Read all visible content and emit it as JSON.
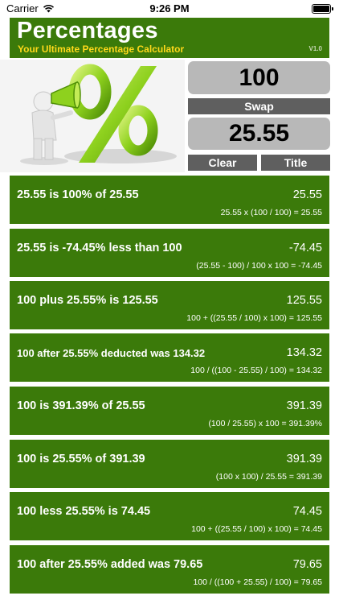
{
  "status_bar": {
    "carrier": "Carrier",
    "time": "9:26 PM"
  },
  "header": {
    "title": "Percentages",
    "subtitle": "Your Ultimate Percentage Calculator",
    "version": "V1.0"
  },
  "inputs": {
    "value_a": "100",
    "value_b": "25.55"
  },
  "buttons": {
    "swap": "Swap",
    "clear": "Clear",
    "title": "Title"
  },
  "hero": {
    "icon": "percent-megaphone-illustration"
  },
  "results": [
    {
      "statement": "25.55 is 100% of 25.55",
      "value": "25.55",
      "formula": "25.55 x (100 / 100) = 25.55"
    },
    {
      "statement": "25.55 is -74.45% less than 100",
      "value": "-74.45",
      "formula": "(25.55 - 100) / 100 x 100 = -74.45"
    },
    {
      "statement": "100 plus 25.55% is 125.55",
      "value": "125.55",
      "formula": "100 + ((25.55 / 100) x 100) = 125.55"
    },
    {
      "statement": "100 after 25.55% deducted was 134.32",
      "value": "134.32",
      "formula": "100 / ((100 - 25.55) / 100) = 134.32"
    },
    {
      "statement": "100 is 391.39% of 25.55",
      "value": "391.39",
      "formula": "(100 / 25.55) x 100 = 391.39%"
    },
    {
      "statement": "100 is 25.55% of 391.39",
      "value": "391.39",
      "formula": "(100 x 100) / 25.55 = 391.39"
    },
    {
      "statement": "100 less 25.55% is 74.45",
      "value": "74.45",
      "formula": "100 + ((25.55 / 100) x 100) = 74.45"
    },
    {
      "statement": "100 after 25.55% added was 79.65",
      "value": "79.65",
      "formula": "100 / ((100 + 25.55) / 100) = 79.65"
    }
  ],
  "colors": {
    "brand_green": "#3b7a0a",
    "accent_yellow": "#ffd91a",
    "button_gray": "#5f5f5f",
    "input_gray": "#b8b8b8"
  }
}
